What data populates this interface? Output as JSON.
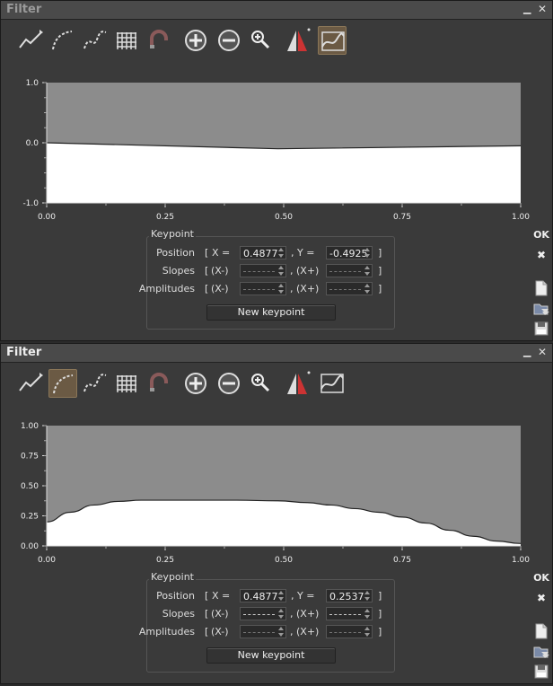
{
  "panels": [
    {
      "title": "Filter",
      "active_tool": 9,
      "plot": {
        "y_ticks": [
          "1.0",
          "0.0",
          "-1.0"
        ],
        "y_values": [
          1,
          0,
          -1
        ],
        "ylim": [
          -1,
          1
        ],
        "x_ticks": [
          "0.00",
          "0.25",
          "0.50",
          "0.75",
          "1.00"
        ],
        "x_values": [
          0,
          0.25,
          0.5,
          0.75,
          1
        ],
        "curve": [
          [
            0,
            0.0
          ],
          [
            0.4877,
            -0.1
          ],
          [
            1,
            -0.05
          ]
        ],
        "curve_type": "linear"
      },
      "keypoint": {
        "group_title": "Keypoint",
        "position_label": "Position",
        "x_label": "X =",
        "x_value": "0.4877",
        "y_label": ", Y =",
        "y_value": "-0.4925",
        "slopes_label": "Slopes",
        "amplitudes_label": "Amplitudes",
        "minus_label": "(X-)",
        "plus_label": ", (X+)",
        "open_bracket": "[",
        "close_bracket": "]",
        "new_button": "New keypoint"
      },
      "side": {
        "ok": "OK",
        "close": "✖"
      }
    },
    {
      "title": "Filter",
      "active_tool": 1,
      "plot": {
        "y_ticks": [
          "1.00",
          "0.75",
          "0.50",
          "0.25",
          "0.00"
        ],
        "y_values": [
          1,
          0.75,
          0.5,
          0.25,
          0
        ],
        "ylim": [
          0,
          1
        ],
        "x_ticks": [
          "0.00",
          "0.25",
          "0.50",
          "0.75",
          "1.00"
        ],
        "x_values": [
          0,
          0.25,
          0.5,
          0.75,
          1
        ],
        "curve": [
          [
            0,
            0.2
          ],
          [
            0.05,
            0.28
          ],
          [
            0.1,
            0.34
          ],
          [
            0.15,
            0.37
          ],
          [
            0.2,
            0.38
          ],
          [
            0.3,
            0.38
          ],
          [
            0.4,
            0.38
          ],
          [
            0.4877,
            0.375
          ],
          [
            0.55,
            0.36
          ],
          [
            0.6,
            0.34
          ],
          [
            0.65,
            0.31
          ],
          [
            0.7,
            0.28
          ],
          [
            0.75,
            0.24
          ],
          [
            0.8,
            0.19
          ],
          [
            0.85,
            0.13
          ],
          [
            0.9,
            0.08
          ],
          [
            0.95,
            0.04
          ],
          [
            1,
            0.02
          ]
        ],
        "curve_type": "smooth"
      },
      "keypoint": {
        "group_title": "Keypoint",
        "position_label": "Position",
        "x_label": "X =",
        "x_value": "0.4877",
        "y_label": ", Y =",
        "y_value": "0.2537",
        "slopes_label": "Slopes",
        "amplitudes_label": "Amplitudes",
        "minus_label": "(X-)",
        "plus_label": ", (X+)",
        "open_bracket": "[",
        "close_bracket": "]",
        "new_button": "New keypoint"
      },
      "side": {
        "ok": "OK",
        "close": "✖"
      }
    }
  ],
  "toolbar_icons": [
    "linear-curve-icon",
    "smooth-curve-icon",
    "spline-curve-icon",
    "grid-icon",
    "magnet-icon",
    "zoom-in-icon",
    "zoom-out-icon",
    "zoom-fit-icon",
    "mirror-icon",
    "preview-curve-icon"
  ],
  "colors": {
    "fill": "#ffffff",
    "plot_bg": "#8c8c8c",
    "panel": "#3a3a3a",
    "active_tool": "#6b5a44"
  }
}
